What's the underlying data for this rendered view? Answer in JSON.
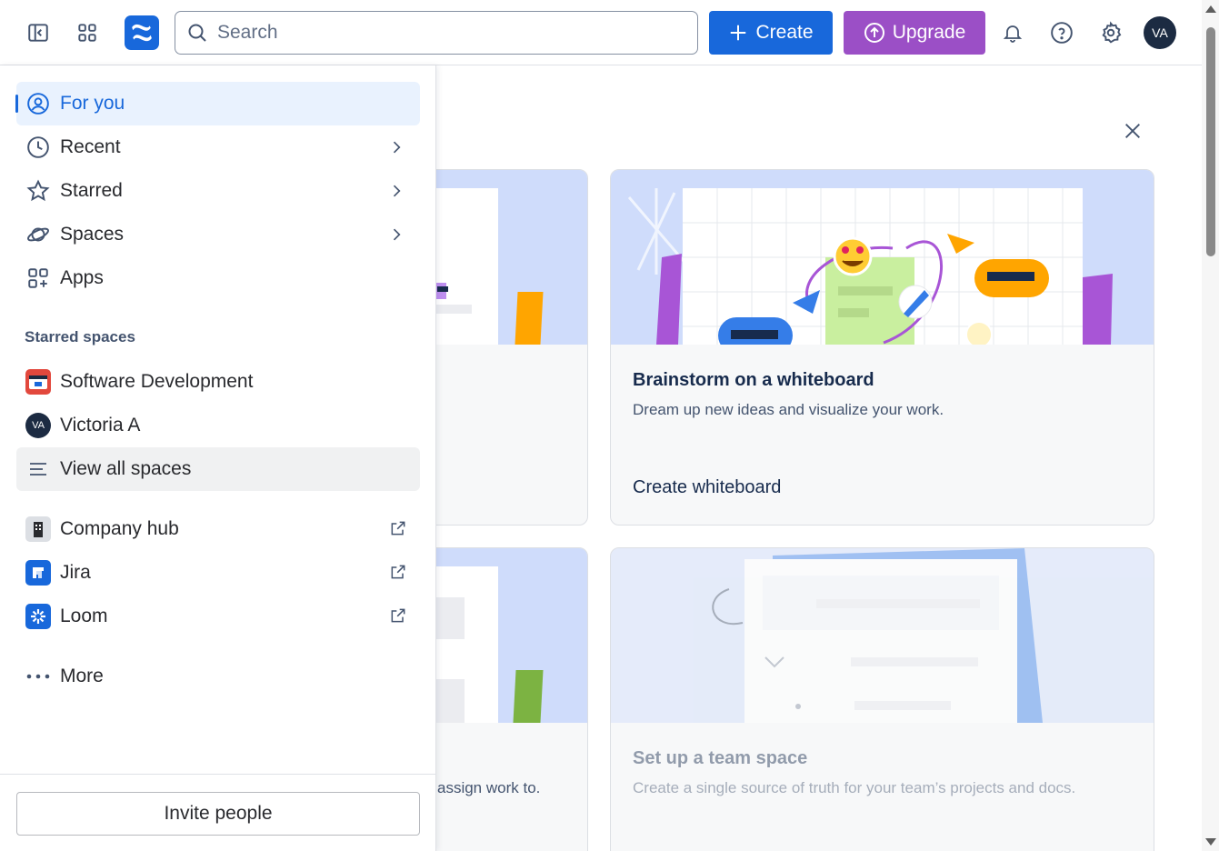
{
  "topbar": {
    "search_placeholder": "Search",
    "create_label": "Create",
    "upgrade_label": "Upgrade",
    "avatar_initials": "VA"
  },
  "sidebar": {
    "nav": [
      {
        "label": "For you",
        "icon": "user-circle-icon"
      },
      {
        "label": "Recent",
        "icon": "clock-icon"
      },
      {
        "label": "Starred",
        "icon": "star-icon"
      },
      {
        "label": "Spaces",
        "icon": "planet-icon"
      },
      {
        "label": "Apps",
        "icon": "apps-icon"
      }
    ],
    "starred_title": "Starred spaces",
    "starred": [
      {
        "label": "Software Development",
        "icon": "calendar-space-icon"
      },
      {
        "label": "Victoria A",
        "initials": "VA"
      }
    ],
    "view_all": "View all spaces",
    "links": [
      {
        "label": "Company hub",
        "icon": "building-icon"
      },
      {
        "label": "Jira",
        "icon": "jira-icon"
      },
      {
        "label": "Loom",
        "icon": "loom-icon"
      }
    ],
    "more": "More",
    "invite": "Invite people"
  },
  "main": {
    "cards": [
      {
        "title": "Brainstorm on a whiteboard",
        "desc": "Dream up new ideas and visualize your work.",
        "action": "Create whiteboard"
      },
      {
        "title": "Set up a team space",
        "desc": "Create a single source of truth for your team’s projects and docs."
      }
    ],
    "partial_text": "assign work to."
  },
  "colors": {
    "brand_blue": "#1868db",
    "upgrade_purple": "#9b4fc6",
    "avatar_navy": "#1c2b42"
  }
}
